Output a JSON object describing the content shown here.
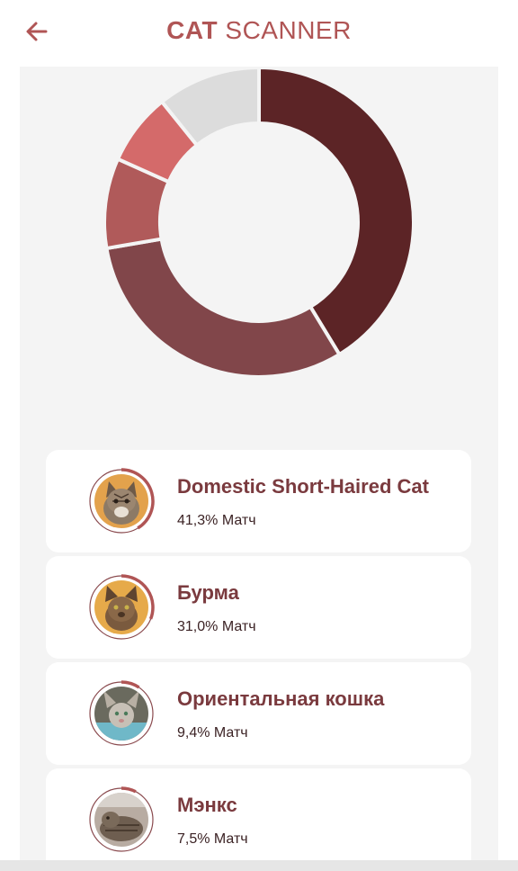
{
  "header": {
    "title_bold": "CAT",
    "title_rest": "SCANNER",
    "back_icon": "arrow-left-icon"
  },
  "colors": {
    "accent": "#b05555",
    "segments": [
      "#5c2426",
      "#81464a",
      "#b05a5a",
      "#d46a6a",
      "#dcdcdc"
    ]
  },
  "chart_data": {
    "type": "pie",
    "subtype": "donut",
    "values": [
      41.3,
      31.0,
      9.4,
      7.5,
      10.8
    ]
  },
  "results": [
    {
      "name": "Domestic Short-Haired Cat",
      "match": "41,3% Матч",
      "percent": 41.3,
      "avatar": "cat-avatar-tabby"
    },
    {
      "name": "Бурма",
      "match": "31,0% Матч",
      "percent": 31.0,
      "avatar": "cat-avatar-burmese"
    },
    {
      "name": "Ориентальная кошка",
      "match": "9,4% Матч",
      "percent": 9.4,
      "avatar": "cat-avatar-oriental"
    },
    {
      "name": "Мэнкс",
      "match": "7,5% Матч",
      "percent": 7.5,
      "avatar": "cat-avatar-manx"
    }
  ]
}
